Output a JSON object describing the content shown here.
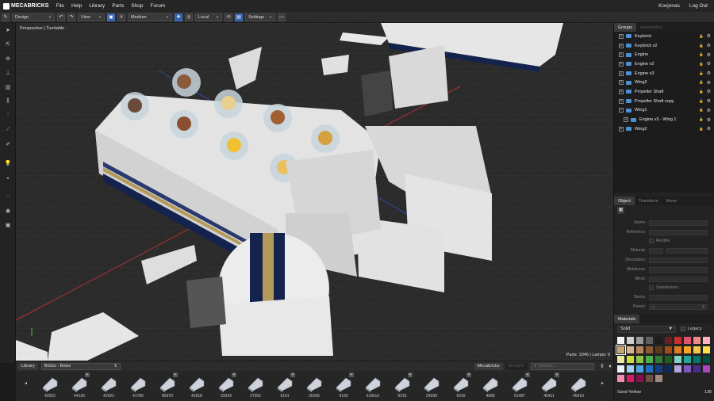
{
  "menubar": {
    "logo": "MECABRICKS",
    "items": [
      "File",
      "Help",
      "Library",
      "Parts",
      "Shop",
      "Forum"
    ],
    "user": "Kovjonas",
    "logout": "Log Out"
  },
  "toolbar": {
    "mode": "Design",
    "view": "View",
    "quality": "Medium",
    "space": "Local",
    "settings": "Settings"
  },
  "viewport": {
    "camera": "Perspective | Turntable",
    "space": "Space",
    "status": "Parts: 1046 | Lamps: 0"
  },
  "library": {
    "tab": "Library",
    "category": "Bricks - Bows",
    "source_active": "Mecabricks",
    "source_other": "Bricklink",
    "search_placeholder": "Search...",
    "parts": [
      "42022",
      "44126",
      "42023",
      "41766",
      "85970",
      "42918",
      "33243",
      "37352",
      "6191",
      "30165",
      "6192",
      "6192v2",
      "6215",
      "24599",
      "6216",
      "4068",
      "61487",
      "45411",
      "45410"
    ]
  },
  "groups": {
    "tab_active": "Groups",
    "tab_other": "Assemblies",
    "items": [
      {
        "label": "Keybrick",
        "level": 0,
        "expanded": false
      },
      {
        "label": "Keybrick v2",
        "level": 0,
        "expanded": false
      },
      {
        "label": "Engine",
        "level": 0,
        "expanded": false
      },
      {
        "label": "Engine v2",
        "level": 0,
        "expanded": false
      },
      {
        "label": "Engine v3",
        "level": 0,
        "expanded": false
      },
      {
        "label": "Wing2",
        "level": 0,
        "expanded": false
      },
      {
        "label": "Propeller Shaft",
        "level": 0,
        "expanded": false
      },
      {
        "label": "Propeller Shaft copy",
        "level": 0,
        "expanded": false
      },
      {
        "label": "Wing1",
        "level": 0,
        "expanded": true
      },
      {
        "label": "Engine v3 - Wing 1",
        "level": 1,
        "expanded": false
      },
      {
        "label": "Wing2",
        "level": 0,
        "expanded": false
      }
    ]
  },
  "object_panel": {
    "tabs": [
      "Object",
      "Transform",
      "Move"
    ],
    "fields": [
      "Name:",
      "Reference:",
      "Material:",
      "Decoration:",
      "Metalness:",
      "Mesh:",
      "Bump:",
      "Parent:"
    ],
    "flexible": "Flexible",
    "subdivisions": "Subdivisions",
    "parent_value": "6"
  },
  "materials": {
    "header": "Materials",
    "type": "Solid",
    "legacy": "Legacy",
    "selected_name": "Sand Yellow",
    "selected_id": "138",
    "colors": [
      [
        "#f2f2f2",
        "#cfcfcf",
        "#9a9a9a",
        "#5f5f5f",
        "#1c1c1c",
        "#6b1f1f",
        "#c9302c",
        "#e0556d",
        "#f08a8a",
        "#ffb5c0"
      ],
      [
        "#c5a572",
        "#d9b38c",
        "#b88659",
        "#8a5a32",
        "#5b3a1e",
        "#a44b14",
        "#e07b22",
        "#f5a623",
        "#f7c948",
        "#ffe14d"
      ],
      [
        "#e9e9a0",
        "#c8e03a",
        "#8bc34a",
        "#4caf50",
        "#2e7d32",
        "#1b5e20",
        "#7fd4c1",
        "#26a69a",
        "#00796b",
        "#004d40"
      ],
      [
        "#e8f4fb",
        "#9ed2f0",
        "#4fa3e0",
        "#1e6fc2",
        "#123f8a",
        "#0d2a5e",
        "#b3a4e0",
        "#7e57c2",
        "#4a2c8a",
        "#ab47bc"
      ],
      [
        "#f48fb1",
        "#d81b60",
        "#880e4f",
        "#6d4c41",
        "#a1887f"
      ]
    ]
  }
}
